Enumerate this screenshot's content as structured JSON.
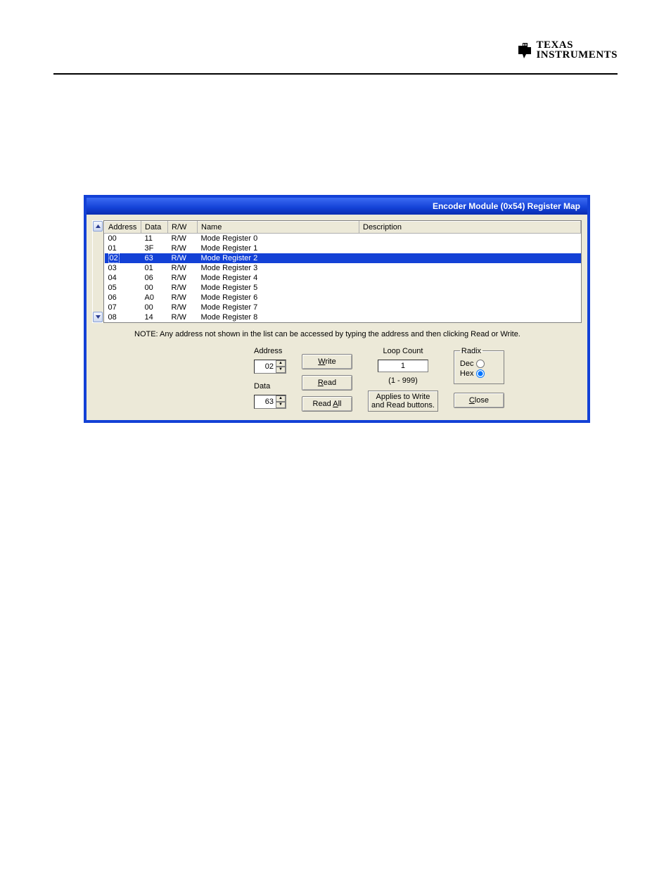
{
  "logo": {
    "line1": "TEXAS",
    "line2": "INSTRUMENTS"
  },
  "window": {
    "title": "Encoder Module (0x54) Register Map"
  },
  "columns": {
    "address": "Address",
    "data": "Data",
    "rw": "R/W",
    "name": "Name",
    "description": "Description"
  },
  "rows": [
    {
      "address": "00",
      "data": "11",
      "rw": "R/W",
      "name": "Mode Register 0",
      "description": ""
    },
    {
      "address": "01",
      "data": "3F",
      "rw": "R/W",
      "name": "Mode Register 1",
      "description": ""
    },
    {
      "address": "02",
      "data": "63",
      "rw": "R/W",
      "name": "Mode Register 2",
      "description": ""
    },
    {
      "address": "03",
      "data": "01",
      "rw": "R/W",
      "name": "Mode Register 3",
      "description": ""
    },
    {
      "address": "04",
      "data": "06",
      "rw": "R/W",
      "name": "Mode Register 4",
      "description": ""
    },
    {
      "address": "05",
      "data": "00",
      "rw": "R/W",
      "name": "Mode Register 5",
      "description": ""
    },
    {
      "address": "06",
      "data": "A0",
      "rw": "R/W",
      "name": "Mode Register 6",
      "description": ""
    },
    {
      "address": "07",
      "data": "00",
      "rw": "R/W",
      "name": "Mode Register 7",
      "description": ""
    },
    {
      "address": "08",
      "data": "14",
      "rw": "R/W",
      "name": "Mode Register 8",
      "description": ""
    }
  ],
  "selected_index": 2,
  "note": "NOTE: Any address not shown in the list can be accessed by typing the address and then clicking Read or Write.",
  "controls": {
    "address_label": "Address",
    "address_value": "02",
    "data_label": "Data",
    "data_value": "63",
    "write_label_pre": "",
    "write_u": "W",
    "write_label_post": "rite",
    "read_u": "R",
    "read_label_post": "ead",
    "readall_pre": "Read ",
    "readall_u": "A",
    "readall_post": "ll",
    "loop_label": "Loop Count",
    "loop_value": "1",
    "loop_range": "(1 - 999)",
    "loop_note1": "Applies to Write",
    "loop_note2": "and Read buttons.",
    "radix_legend": "Radix",
    "radix_dec": "Dec",
    "radix_hex": "Hex",
    "radix_selected": "hex",
    "close_u": "C",
    "close_post": "lose"
  }
}
